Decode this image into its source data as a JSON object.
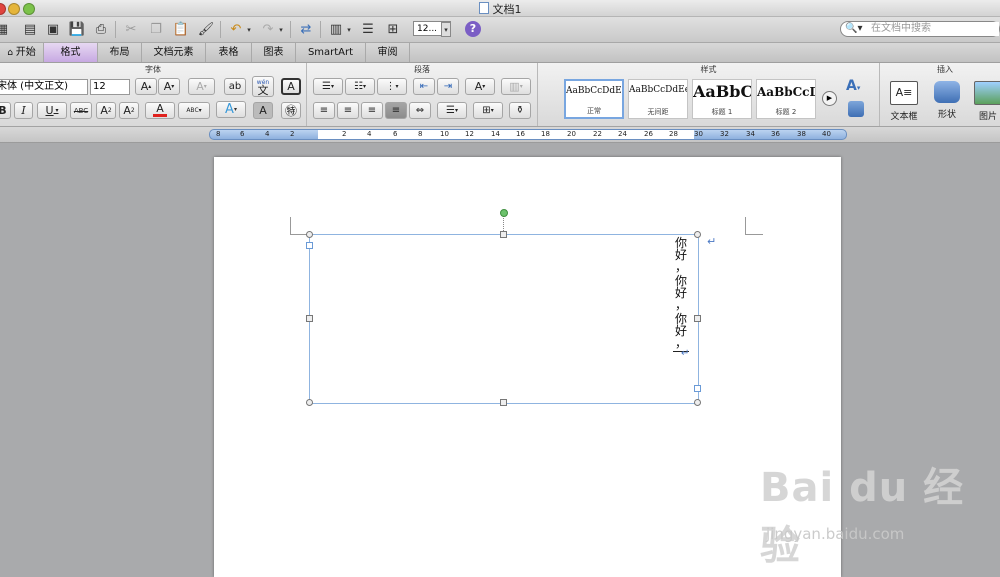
{
  "window": {
    "title": "文档1"
  },
  "toolbar": {
    "zoom": "12...",
    "search_placeholder": "在文档中搜索"
  },
  "tabs": [
    {
      "label": "开始",
      "active": false
    },
    {
      "label": "格式",
      "active": true
    },
    {
      "label": "布局",
      "active": false
    },
    {
      "label": "文档元素",
      "active": false
    },
    {
      "label": "表格",
      "active": false
    },
    {
      "label": "图表",
      "active": false
    },
    {
      "label": "SmartArt",
      "active": false
    },
    {
      "label": "审阅",
      "active": false
    }
  ],
  "ribbon": {
    "font_group": {
      "title": "字体",
      "font_name": "宋体 (中文正文)",
      "font_size": "12",
      "wen_label": "wén",
      "wen_char": "文"
    },
    "paragraph_group": {
      "title": "段落"
    },
    "styles_group": {
      "title": "样式",
      "styles": [
        {
          "preview": "AaBbCcDdEe",
          "name": "正常"
        },
        {
          "preview": "AaBbCcDdEe",
          "name": "无间距"
        },
        {
          "preview": "AaBbC",
          "name": "标题 1"
        },
        {
          "preview": "AaBbCcDe",
          "name": "标题 2"
        }
      ]
    },
    "insert_group": {
      "title": "插入",
      "items": [
        {
          "label": "文本框"
        },
        {
          "label": "形状"
        },
        {
          "label": "图片"
        }
      ]
    }
  },
  "ruler": {
    "labels": [
      "8",
      "6",
      "4",
      "2",
      "2",
      "4",
      "6",
      "8",
      "10",
      "12",
      "14",
      "16",
      "18",
      "20",
      "22",
      "24",
      "26",
      "28",
      "30",
      "32",
      "34",
      "36",
      "38",
      "40"
    ]
  },
  "document": {
    "text_chars": [
      "你",
      "好",
      "，",
      "你",
      "好",
      "，",
      "你",
      "好",
      "，"
    ]
  },
  "watermark": {
    "logo": "Bai du 经验",
    "url": "jingyan.baidu.com"
  },
  "colors": {
    "accent_tab": "#c7a9e2",
    "textbox_border": "#8fb4e0",
    "rotate_handle": "#5cb85c",
    "font_color_bar": "#e0211d"
  }
}
